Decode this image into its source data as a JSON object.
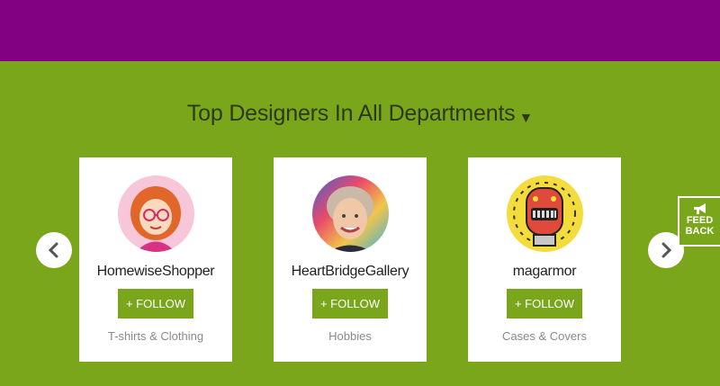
{
  "heading": {
    "title": "Top Designers In All Departments",
    "caret": "▼"
  },
  "designers": [
    {
      "name": "HomewiseShopper",
      "follow_label": "+ FOLLOW",
      "category": "T-shirts & Clothing"
    },
    {
      "name": "HeartBridgeGallery",
      "follow_label": "+ FOLLOW",
      "category": "Hobbies"
    },
    {
      "name": "magarmor",
      "follow_label": "+ FOLLOW",
      "category": "Cases & Covers"
    }
  ],
  "feedback": {
    "line1": "FEED",
    "line2": "BACK"
  },
  "colors": {
    "header": "#820082",
    "accent": "#7aa61c"
  },
  "icons": {
    "prev": "chevron-left-icon",
    "next": "chevron-right-icon",
    "feedback": "megaphone-icon"
  }
}
